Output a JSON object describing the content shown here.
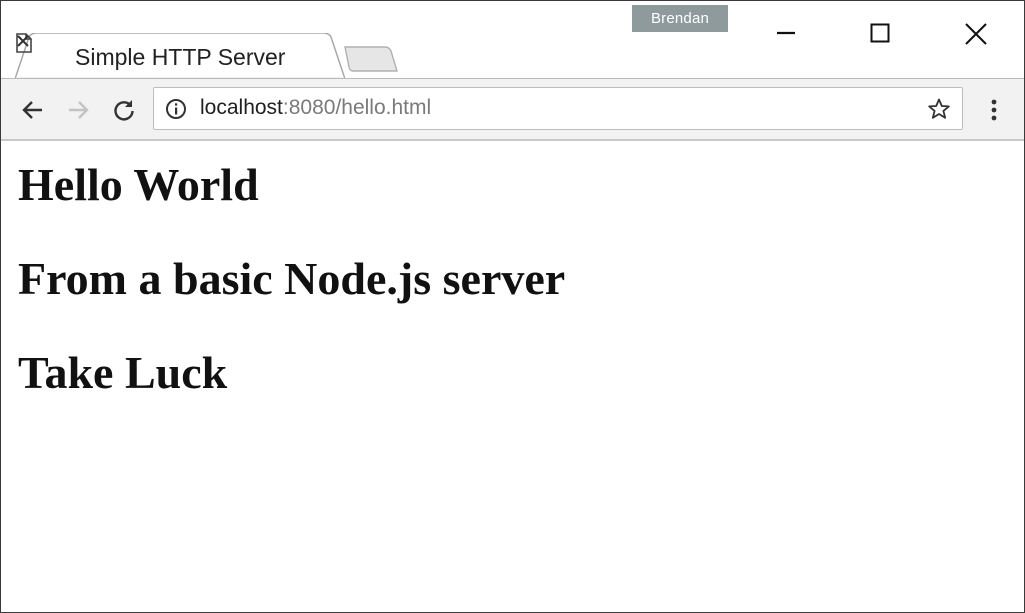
{
  "window": {
    "profile_name": "Brendan",
    "controls": {
      "minimize": "minimize",
      "maximize": "maximize",
      "close": "close"
    }
  },
  "tabs": [
    {
      "title": "Simple HTTP Server",
      "active": true,
      "icon": "page-icon"
    }
  ],
  "toolbar": {
    "url_host": "localhost",
    "url_rest": ":8080/hello.html",
    "icons": [
      "back-icon",
      "forward-icon",
      "reload-icon",
      "info-icon",
      "bookmark-star-icon",
      "menu-icon"
    ]
  },
  "page": {
    "headings": [
      "Hello World",
      "From a basic Node.js server",
      "Take Luck"
    ]
  },
  "colors": {
    "profile_badge": "#8e9a9c",
    "toolbar_bg": "#f2f2f2",
    "url_dim": "#7a7a7a"
  }
}
